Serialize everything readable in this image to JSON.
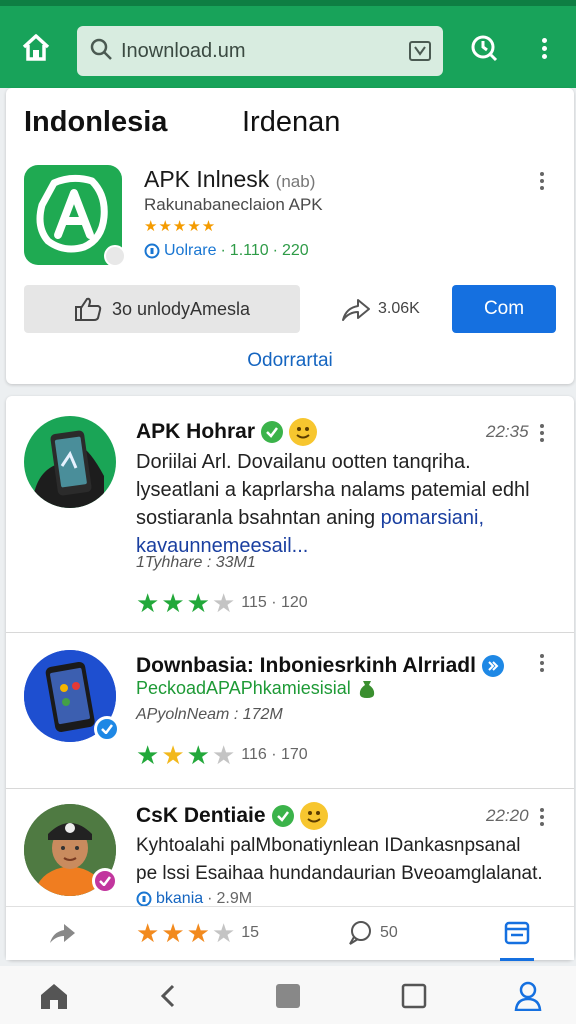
{
  "header": {
    "search_text": "Inownload.um"
  },
  "tabs": {
    "first": "Indonlesia",
    "second": "Irdenan"
  },
  "app": {
    "title": "APK Inlnesk",
    "title_suffix": "(nab)",
    "subtitle": "Rakunabaneclaion APK",
    "stars": "★★★★★",
    "meta_label": "Uolrare",
    "meta_sep1": "·",
    "meta_value1": "1.110",
    "meta_sep2": "·",
    "meta_value2": "220",
    "download_label": "3o unlodyAmesla",
    "share_count": "3.06K",
    "primary_button": "Com",
    "link": "Odorrartai"
  },
  "feed": [
    {
      "title": "APK Hohrar",
      "time": "22:35",
      "body_line1": "Doriilai Arl. Dovailanu ootten tanqriha.",
      "body_line2": "lyseatlani a kaprlarsha nalams patemial edhl",
      "body_line3_a": "sostiaranla bsahntan aning ",
      "body_line3_b": "pomarsiani,",
      "body_line4": "kavaunnemeesail...",
      "meta": "1Tyhhare : 33M1",
      "rating_text": "115 · 120"
    },
    {
      "title": "Downbasia: Inboniesrkinh Alrriadl",
      "subline": "PeckoadAPAPhkamiesisial",
      "meta": "APyolnNeam : 172M",
      "rating_text": "116 · 170"
    },
    {
      "title": "CsK Dentiaie",
      "time": "22:20",
      "body_line1": "Kyhtoalahi palMbonatiynlean IDankasnpsanal",
      "body_line2": "pe lssi Esaihaa hundandaurian Bveoamglalanat.",
      "meta_label": "bkania",
      "meta_value": "2.9M"
    }
  ],
  "action_strip": {
    "rating_text": "15",
    "comment_count": "50"
  },
  "colors": {
    "brand_green": "#18a35a",
    "primary_blue": "#1570e0",
    "star_green": "#22a83a",
    "star_yellow": "#f2b81c",
    "star_orange": "#f28a1e",
    "star_gray": "#c4c4c4"
  }
}
